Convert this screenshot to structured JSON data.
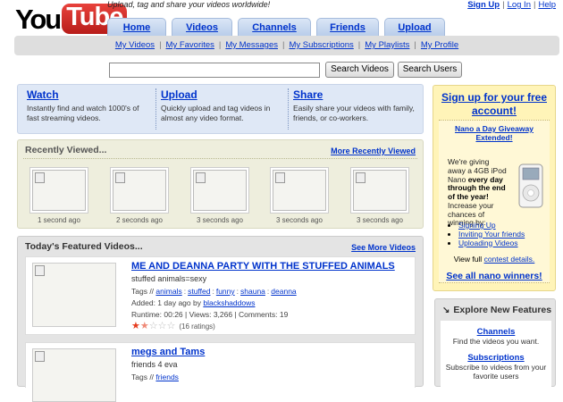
{
  "header": {
    "logo_you": "You",
    "logo_tube": "Tube",
    "tagline": "Upload, tag and share your videos worldwide!",
    "links": [
      "Sign Up",
      "Log In",
      "Help"
    ]
  },
  "tabs": [
    "Home",
    "Videos",
    "Channels",
    "Friends",
    "Upload"
  ],
  "subnav": [
    "My Videos",
    "My Favorites",
    "My Messages",
    "My Subscriptions",
    "My Playlists",
    "My Profile"
  ],
  "search": {
    "value": "",
    "btn_videos": "Search Videos",
    "btn_users": "Search Users"
  },
  "info": [
    {
      "title": "Watch",
      "text": "Instantly find and watch 1000's of fast streaming videos."
    },
    {
      "title": "Upload",
      "text": "Quickly upload and tag videos in almost any video format."
    },
    {
      "title": "Share",
      "text": "Easily share your videos with family, friends, or co-workers."
    }
  ],
  "recent": {
    "title": "Recently Viewed...",
    "more": "More Recently Viewed",
    "times": [
      "1 second ago",
      "2 seconds ago",
      "3 seconds ago",
      "3 seconds ago",
      "3 seconds ago"
    ]
  },
  "featured": {
    "title": "Today's Featured Videos...",
    "more": "See More Videos",
    "videos": [
      {
        "title": "ME AND DEANNA PARTY WITH THE STUFFED ANIMALS",
        "desc": "stuffed animals=sexy",
        "tags_label": "Tags //",
        "tags": [
          "animals",
          "stuffed",
          "funny",
          "shauna",
          "deanna"
        ],
        "added": "Added: 1 day ago by",
        "user": "blackshaddows",
        "stats": "Runtime: 00:26 | Views: 3,266 | Comments: 19",
        "rating": 1.5,
        "ratings_text": "(16 ratings)"
      },
      {
        "title": "megs and Tams",
        "desc": "friends 4 eva",
        "tags_label": "Tags //",
        "tags": [
          "friends"
        ]
      }
    ]
  },
  "signup": {
    "headline": "Sign up for your free account!",
    "promo": "Nano a Day Giveaway Extended!",
    "body_1": "We're giving away a 4GB iPod Nano ",
    "body_bold": "every day through the end of the year!",
    "body_2": " Increase your chances of winning by:",
    "items": [
      "Signing Up",
      "Inviting Your friends",
      "Uploading Videos"
    ],
    "full_label": "View full",
    "full_link": "contest details.",
    "winners": "See all nano winners!"
  },
  "explore": {
    "title": "Explore New Features",
    "items": [
      {
        "title": "Channels",
        "text": "Find the videos you want."
      },
      {
        "title": "Subscriptions",
        "text": "Subscribe to videos from your favorite users"
      }
    ]
  },
  "colors": {
    "link": "#0033cc",
    "logo_red": "#c41e1e",
    "star": "#e63c1e"
  }
}
